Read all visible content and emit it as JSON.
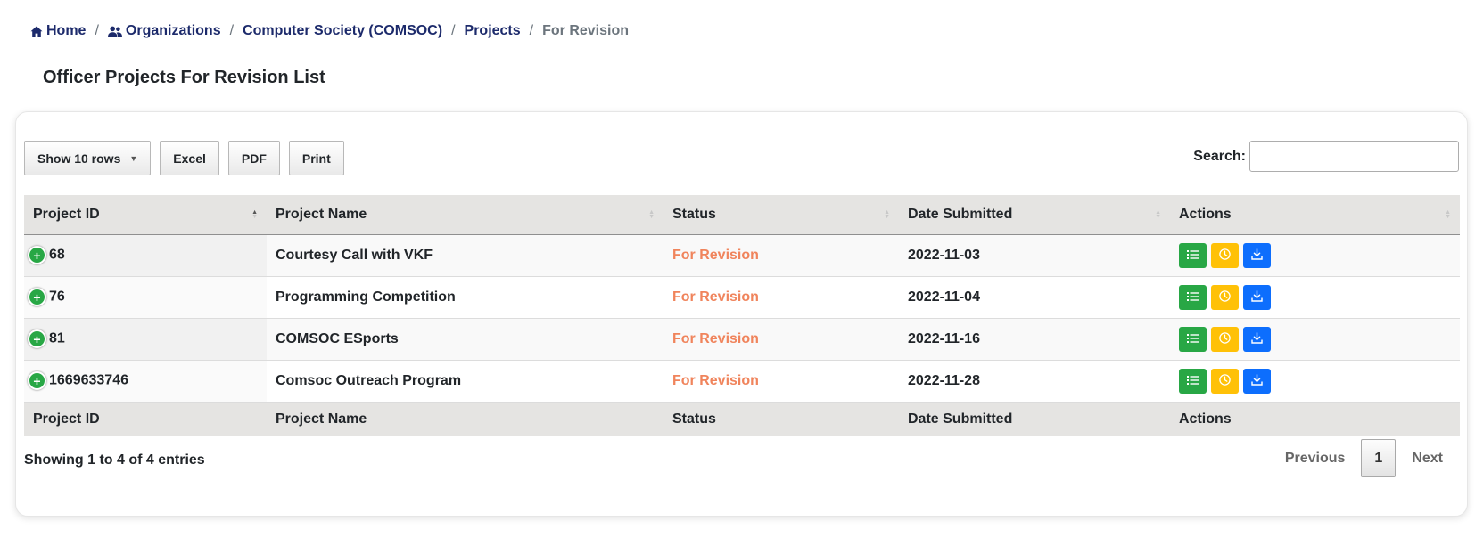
{
  "breadcrumb": {
    "home": "Home",
    "organizations": "Organizations",
    "org": "Computer Society (COMSOC)",
    "projects": "Projects",
    "current": "For Revision"
  },
  "page_title": "Officer Projects For Revision List",
  "toolbar": {
    "show_rows": "Show 10 rows",
    "excel": "Excel",
    "pdf": "PDF",
    "print": "Print"
  },
  "search": {
    "label": "Search:",
    "value": ""
  },
  "table": {
    "columns": [
      "Project ID",
      "Project Name",
      "Status",
      "Date Submitted",
      "Actions"
    ],
    "rows": [
      {
        "id": "68",
        "name": "Courtesy Call with VKF",
        "status": "For Revision",
        "date": "2022-11-03"
      },
      {
        "id": "76",
        "name": "Programming Competition",
        "status": "For Revision",
        "date": "2022-11-04"
      },
      {
        "id": "81",
        "name": "COMSOC ESports",
        "status": "For Revision",
        "date": "2022-11-16"
      },
      {
        "id": "1669633746",
        "name": "Comsoc Outreach Program",
        "status": "For Revision",
        "date": "2022-11-28"
      }
    ]
  },
  "info": "Showing 1 to 4 of 4 entries",
  "pagination": {
    "previous": "Previous",
    "current_page": "1",
    "next": "Next"
  },
  "colors": {
    "status": "#f0845c",
    "details": "#28a745",
    "history": "#ffc107",
    "download": "#0d6efd",
    "link": "#1c2a6b"
  },
  "icons": [
    "home-icon",
    "users-icon",
    "plus-circle-icon",
    "list-icon",
    "clock-icon",
    "download-icon",
    "sort-icon"
  ]
}
